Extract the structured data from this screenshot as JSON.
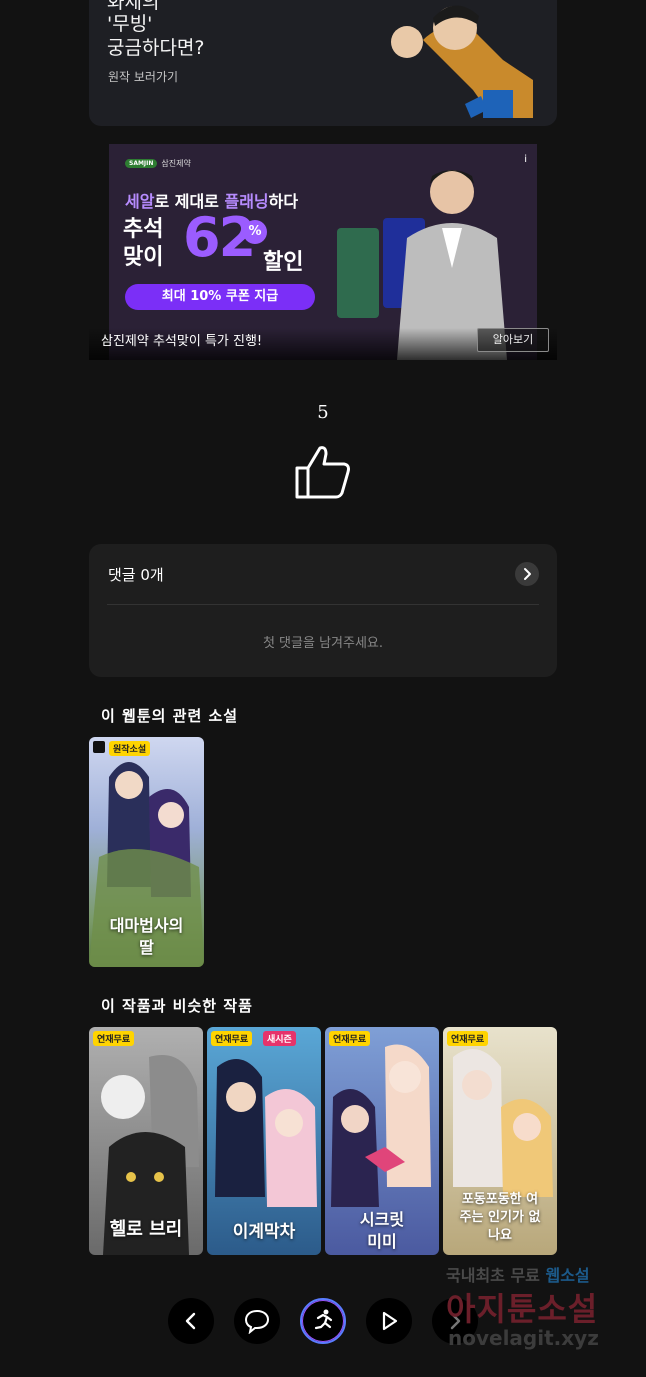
{
  "promo": {
    "line1": "화제의",
    "line2": "'무빙'",
    "line3": "궁금하다면?",
    "link": "원작 보러가기"
  },
  "ad": {
    "brand": "삼진제약",
    "brand_pill": "SAMJIN",
    "headline": "세알로 제대로 플래닝하다",
    "headline_highlight_1": "세알",
    "headline_highlight_2": "플래닝",
    "line_a": "추석",
    "line_b": "맞이",
    "discount_number": "62",
    "discount_pct": "%",
    "discount_suffix": "할인",
    "coupon": "최대 10% 쿠폰 지급",
    "info_glyph": "i",
    "caption": "삼진제약 추석맞이 특가 진행!",
    "cta": "알아보기"
  },
  "like": {
    "count": "5"
  },
  "comments": {
    "title": "댓글 0개",
    "empty": "첫 댓글을 남겨주세요."
  },
  "related": {
    "title": "이 웹툰의 관련 소설",
    "items": [
      {
        "badge": "원작소설",
        "title": "대마법사의 딸"
      }
    ]
  },
  "similar": {
    "title": "이 작품과 비슷한 작품",
    "items": [
      {
        "badges": [
          "연재무료"
        ],
        "title": "헬로 브리"
      },
      {
        "badges": [
          "연재무료",
          "새시즌"
        ],
        "title": "이계막차"
      },
      {
        "badges": [
          "연재무료"
        ],
        "title": "시크릿 미미"
      },
      {
        "badges": [
          "연재무료"
        ],
        "title": "포동포동한 여주는 인기가 없나요"
      }
    ]
  },
  "nav": {
    "icons": [
      "chevron-left-icon",
      "comment-icon",
      "running-icon",
      "play-icon",
      "chevron-right-icon"
    ]
  },
  "watermark": {
    "line1_prefix": "국내최초 무료",
    "line1_suffix": "웹소설",
    "line2": "아지툰소설",
    "line3": "novelagit.xyz"
  },
  "colors": {
    "background": "#121212",
    "card": "#1e1e1e",
    "badge_yellow": "#ffd400",
    "badge_pink": "#e6336b",
    "ad_purple": "#9b5cff"
  }
}
